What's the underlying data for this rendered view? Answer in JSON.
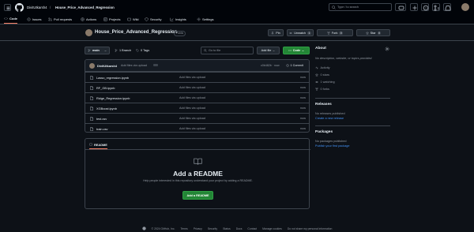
{
  "header": {
    "owner": "DivitUtkarsh4",
    "separator": "/",
    "repo": "House_Price_Advanced_Regression",
    "search_placeholder": "Type / to search"
  },
  "nav": {
    "tabs": [
      {
        "label": "Code",
        "icon": "code-icon",
        "selected": true
      },
      {
        "label": "Issues",
        "icon": "issue-icon"
      },
      {
        "label": "Pull requests",
        "icon": "pull-request-icon"
      },
      {
        "label": "Actions",
        "icon": "play-icon"
      },
      {
        "label": "Projects",
        "icon": "table-icon"
      },
      {
        "label": "Wiki",
        "icon": "book-icon"
      },
      {
        "label": "Security",
        "icon": "shield-icon"
      },
      {
        "label": "Insights",
        "icon": "graph-icon"
      },
      {
        "label": "Settings",
        "icon": "gear-icon"
      }
    ]
  },
  "repo": {
    "title": "House_Price_Advanced_Regression",
    "visibility": "Public",
    "pin_label": "Pin",
    "watch_label": "Unwatch",
    "watch_count": "1",
    "fork_label": "Fork",
    "fork_count": "0",
    "star_label": "Star",
    "star_count": "0"
  },
  "toolbar": {
    "branch": "main",
    "branches": "1 Branch",
    "tags": "0 Tags",
    "goto_placeholder": "Go to file",
    "add_file": "Add file",
    "code": "Code"
  },
  "commit": {
    "author": "DivitUtkarsh4",
    "message": "Add files via upload",
    "hash": "c0b482b · now",
    "commits": "1 Commit"
  },
  "files": [
    {
      "name": "Lasso_regression.ipynb",
      "message": "Add files via upload",
      "date": "now"
    },
    {
      "name": "RF_GB.ipynb",
      "message": "Add files via upload",
      "date": "now"
    },
    {
      "name": "Ridge_Regression.ipynb",
      "message": "Add files via upload",
      "date": "now"
    },
    {
      "name": "XGBoost.ipynb",
      "message": "Add files via upload",
      "date": "now"
    },
    {
      "name": "test.csv",
      "message": "Add files via upload",
      "date": "now"
    },
    {
      "name": "train.csv",
      "message": "Add files via upload",
      "date": "now"
    }
  ],
  "readme": {
    "tab": "README",
    "title": "Add a README",
    "description": "Help people interested in this repository understand your project by adding a README.",
    "button": "Add a README"
  },
  "about": {
    "heading": "About",
    "description": "No description, website, or topics provided.",
    "items": [
      {
        "label": "Activity",
        "icon": "pulse-icon"
      },
      {
        "label": "0 stars",
        "icon": "star-icon"
      },
      {
        "label": "1 watching",
        "icon": "eye-icon"
      },
      {
        "label": "0 forks",
        "icon": "fork-icon"
      }
    ]
  },
  "releases": {
    "heading": "Releases",
    "text": "No releases published",
    "link": "Create a new release"
  },
  "packages": {
    "heading": "Packages",
    "text": "No packages published",
    "link": "Publish your first package"
  },
  "footer": {
    "copyright": "© 2024 GitHub, Inc.",
    "links": [
      "Terms",
      "Privacy",
      "Security",
      "Status",
      "Docs",
      "Contact",
      "Manage cookies",
      "Do not share my personal information"
    ]
  },
  "colors": {
    "accent": "#f78166",
    "primary_button": "#238636",
    "link": "#4493f8",
    "background": "#0d1117"
  }
}
